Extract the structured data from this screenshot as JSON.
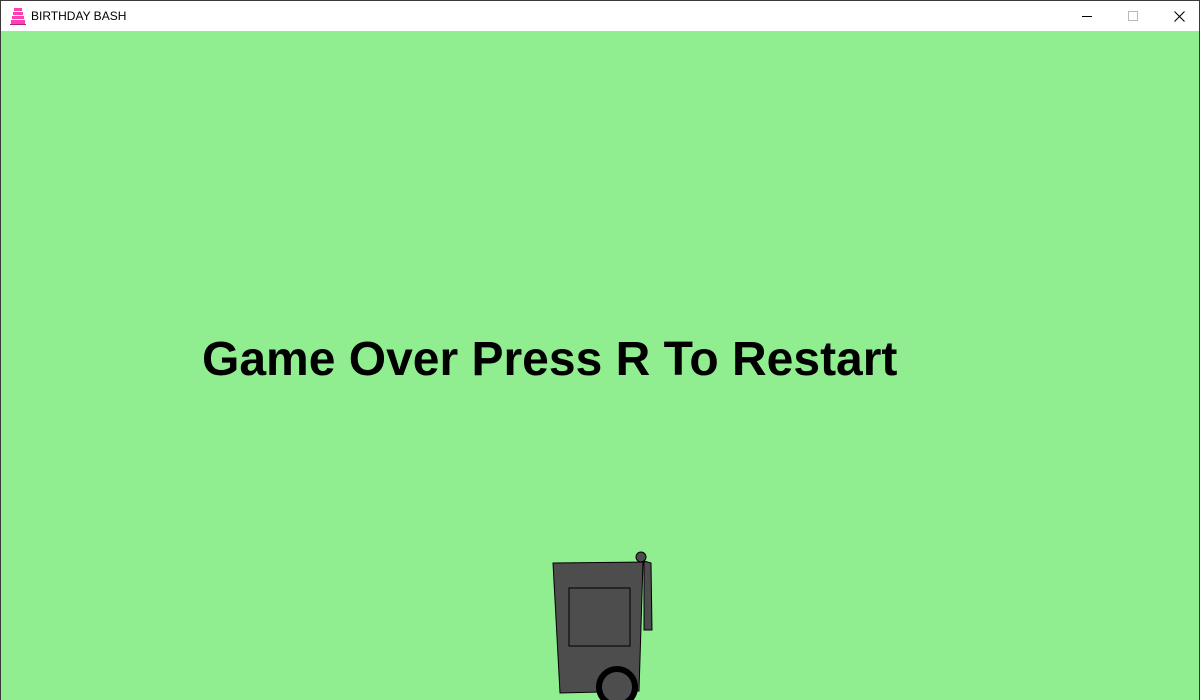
{
  "window": {
    "title": "BIRTHDAY BASH",
    "app_icon": "cake-icon",
    "controls": {
      "minimize_icon": "minimize-icon",
      "maximize_icon": "maximize-icon",
      "close_icon": "close-icon"
    }
  },
  "game": {
    "background_color": "#90ee90",
    "message": "Game Over Press R To Restart",
    "player": {
      "sprite": "trash-can-player",
      "body_color": "#4d4d4d",
      "outline_color": "#000000"
    }
  }
}
